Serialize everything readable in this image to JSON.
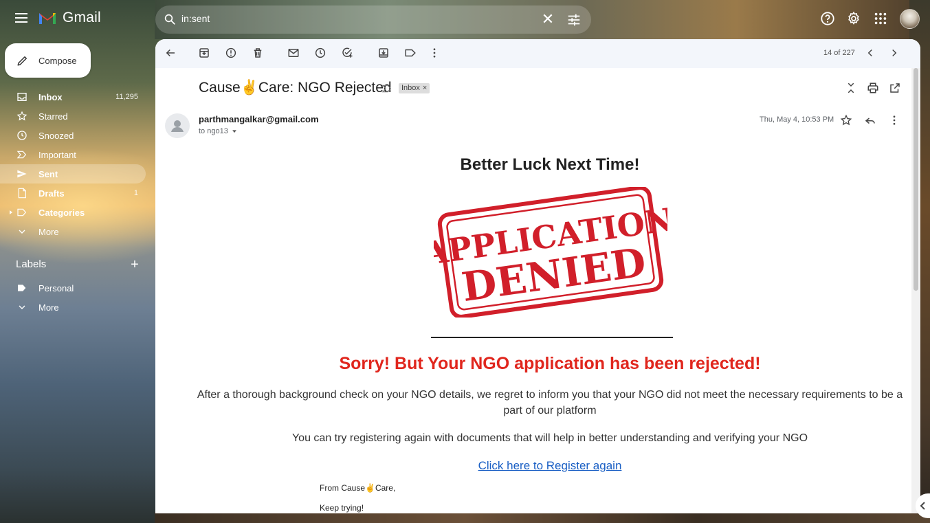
{
  "app": {
    "name": "Gmail"
  },
  "search": {
    "value": "in:sent"
  },
  "compose": {
    "label": "Compose"
  },
  "nav": {
    "items": [
      {
        "label": "Inbox",
        "count": "11,295"
      },
      {
        "label": "Starred",
        "count": ""
      },
      {
        "label": "Snoozed",
        "count": ""
      },
      {
        "label": "Important",
        "count": ""
      },
      {
        "label": "Sent",
        "count": ""
      },
      {
        "label": "Drafts",
        "count": "1"
      },
      {
        "label": "Categories",
        "count": ""
      },
      {
        "label": "More",
        "count": ""
      }
    ]
  },
  "labels": {
    "heading": "Labels",
    "items": [
      {
        "label": "Personal"
      },
      {
        "label": "More"
      }
    ]
  },
  "toolbar": {
    "count_text": "14 of 227"
  },
  "email": {
    "subject_pre": "Cause",
    "subject_emoji": "✌",
    "subject_post": "Care: NGO Rejected",
    "chip_label": "Inbox",
    "chip_close": "×",
    "sender": "parthmangalkar@gmail.com",
    "to": "to ngo13",
    "date": "Thu, May 4, 10:53 PM",
    "heading": "Better Luck Next Time!",
    "stamp_line1": "APPLICATION",
    "stamp_line2": "DENIED",
    "sorry": "Sorry! But Your NGO application has been rejected!",
    "para1": "After a thorough background check on your NGO details, we regret to inform you that your NGO did not meet the necessary requirements to be a part of our platform",
    "para2": "You can try registering again with documents that will help in better understanding and verifying your NGO",
    "link": "Click here to Register again",
    "from_text": "From Cause✌Care,",
    "keep_text": "Keep trying!"
  },
  "colors": {
    "accent_red": "#e0261d",
    "link_blue": "#1a5fc4",
    "stamp_red": "#d11f2a"
  },
  "icons": [
    "menu-icon",
    "gmail-logo",
    "search-icon",
    "close-icon",
    "search-options-icon",
    "help-icon",
    "settings-icon",
    "apps-icon",
    "pencil-icon",
    "inbox-icon",
    "star-icon",
    "clock-icon",
    "label-icon",
    "send-icon",
    "file-icon",
    "chevron-down-icon",
    "back-arrow-icon",
    "archive-icon",
    "report-spam-icon",
    "trash-icon",
    "mail-icon",
    "snooze-icon",
    "add-task-icon",
    "move-icon",
    "more-vert-icon",
    "chevron-left-icon",
    "chevron-right-icon",
    "collapse-icon",
    "print-icon",
    "open-external-icon",
    "reply-icon",
    "person-icon"
  ]
}
